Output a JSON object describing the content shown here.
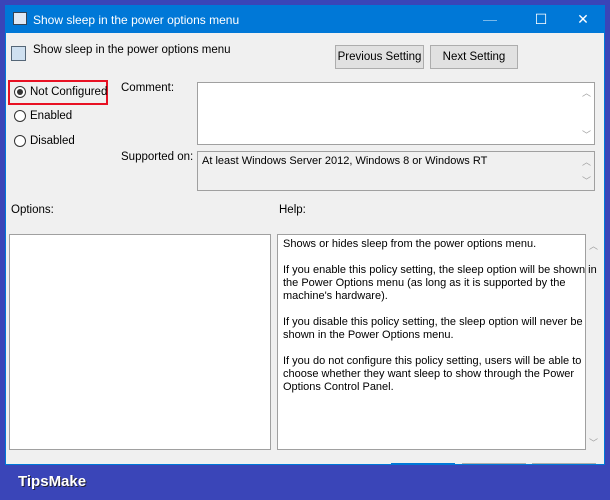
{
  "window": {
    "title": "Show sleep in the power options menu",
    "minimize": "—",
    "maximize": "☐",
    "close": "✕"
  },
  "header": {
    "policy_name": "Show sleep in the power options menu",
    "previous": "Previous Setting",
    "next": "Next Setting"
  },
  "state": {
    "options": [
      {
        "label": "Not Configured",
        "selected": true
      },
      {
        "label": "Enabled",
        "selected": false
      },
      {
        "label": "Disabled",
        "selected": false
      }
    ]
  },
  "comment": {
    "label": "Comment:",
    "value": ""
  },
  "supported": {
    "label": "Supported on:",
    "value": "At least Windows Server 2012, Windows 8 or Windows RT"
  },
  "options_label": "Options:",
  "help": {
    "label": "Help:",
    "lines": [
      "Shows or hides sleep from the power options menu.",
      "",
      "If you enable this policy setting, the sleep option will be shown in",
      "the Power Options menu (as long as it is supported by the",
      "machine's hardware).",
      "",
      "If you disable this policy setting, the sleep option will never be",
      "shown in the Power Options menu.",
      "",
      "If you do not configure this policy setting, users will be able to",
      "choose whether they want sleep to show through the Power",
      "Options Control Panel."
    ]
  },
  "banner": "TipsMake",
  "colors": {
    "titlebar": "#0078d7",
    "frame": "#3a45b8",
    "highlight": "#e81123"
  }
}
